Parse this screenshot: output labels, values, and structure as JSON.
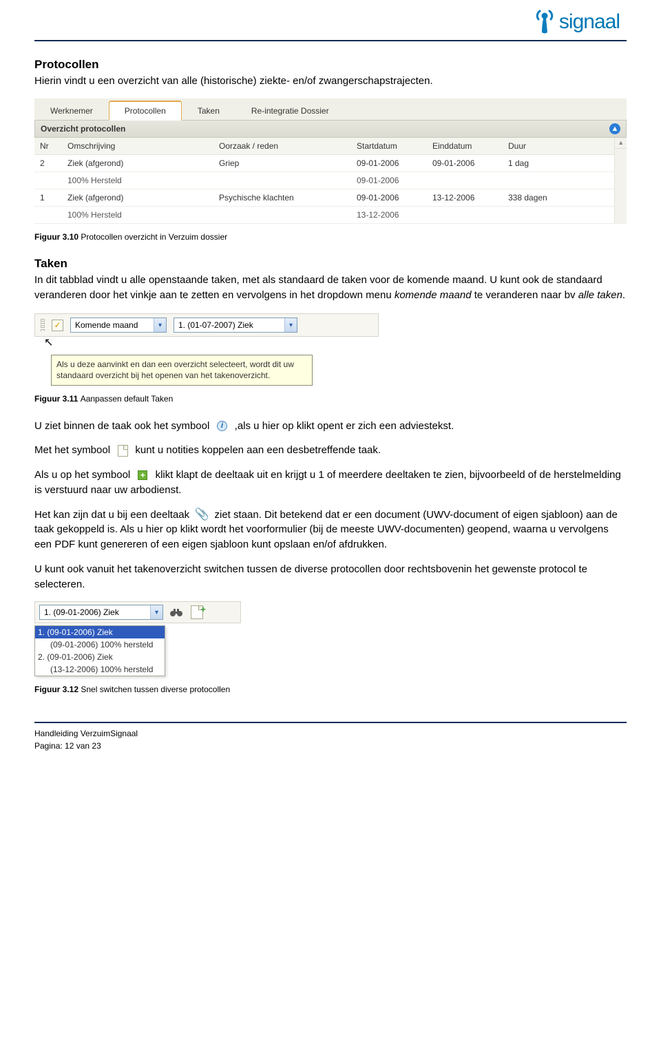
{
  "logo": {
    "brand": "signaal"
  },
  "sections": {
    "protocollen": {
      "heading": "Protocollen",
      "intro": "Hierin vindt u een overzicht van alle (historische) ziekte- en/of zwangerschapstrajecten."
    },
    "taken": {
      "heading": "Taken",
      "para1a": "In dit tabblad vindt u alle openstaande taken, met als standaard de taken voor de komende maand. U kunt ook de standaard veranderen door het vinkje aan te zetten en vervolgens in het dropdown menu ",
      "para1_em1": "komende maand",
      "para1b": " te veranderen naar bv ",
      "para1_em2": "alle taken",
      "para1c": "."
    }
  },
  "shot1": {
    "tabs": [
      "Werknemer",
      "Protocollen",
      "Taken",
      "Re-integratie Dossier"
    ],
    "panel_title": "Overzicht protocollen",
    "columns": [
      "Nr",
      "Omschrijving",
      "Oorzaak / reden",
      "Startdatum",
      "Einddatum",
      "Duur"
    ],
    "rows": [
      {
        "nr": "2",
        "omschrijving": "Ziek (afgerond)",
        "oorzaak": "Griep",
        "start": "09-01-2006",
        "eind": "09-01-2006",
        "duur": "1 dag"
      },
      {
        "nr": "",
        "omschrijving": "100% Hersteld",
        "oorzaak": "",
        "start": "09-01-2006",
        "eind": "",
        "duur": ""
      },
      {
        "nr": "1",
        "omschrijving": "Ziek (afgerond)",
        "oorzaak": "Psychische klachten",
        "start": "09-01-2006",
        "eind": "13-12-2006",
        "duur": "338 dagen"
      },
      {
        "nr": "",
        "omschrijving": "100% Hersteld",
        "oorzaak": "",
        "start": "13-12-2006",
        "eind": "",
        "duur": ""
      }
    ]
  },
  "captions": {
    "c310_b": "Figuur 3.10 ",
    "c310_t": "Protocollen overzicht in Verzuim dossier",
    "c311_b": "Figuur 3.11 ",
    "c311_t": "Aanpassen default Taken",
    "c312_b": "Figuur 3.12 ",
    "c312_t": "Snel switchen tussen diverse protocollen"
  },
  "shot2": {
    "combo1": "Komende maand",
    "combo2": "1. (01-07-2007) Ziek",
    "tooltip": "Als u deze aanvinkt en dan een overzicht selecteert, wordt dit uw standaard overzicht bij het openen van het takenoverzicht."
  },
  "taken_paras": {
    "p2a": "U ziet binnen de taak ook het symbool",
    "p2b": ",als u hier op klikt opent er zich een adviestekst.",
    "p3a": "Met het symbool",
    "p3b": "kunt u notities koppelen aan een desbetreffende taak.",
    "p4a": "Als u op het symbool",
    "p4b": "klikt klapt de deeltaak uit en krijgt u 1 of meerdere deeltaken te zien, bijvoorbeeld of de herstelmelding is verstuurd naar uw arbodienst.",
    "p5a": "Het kan zijn dat u bij een deeltaak",
    "p5b": "ziet staan. Dit betekend dat er een document (UWV-document of eigen sjabloon) aan de taak gekoppeld is. Als u hier op klikt wordt het voorformulier (bij de meeste UWV-documenten) geopend, waarna u vervolgens een PDF kunt genereren of een eigen sjabloon kunt opslaan en/of afdrukken.",
    "p6": "U kunt ook vanuit het takenoverzicht switchen tussen de diverse protocollen door rechtsbovenin het gewenste protocol te selecteren."
  },
  "shot3": {
    "selected": "1. (09-01-2006) Ziek",
    "options": [
      {
        "text": "1. (09-01-2006) Ziek",
        "selected": true,
        "indent": false
      },
      {
        "text": "(09-01-2006) 100% hersteld",
        "selected": false,
        "indent": true
      },
      {
        "text": "2. (09-01-2006) Ziek",
        "selected": false,
        "indent": false
      },
      {
        "text": "(13-12-2006) 100% hersteld",
        "selected": false,
        "indent": true
      }
    ]
  },
  "footer": {
    "line1": "Handleiding VerzuimSignaal",
    "line2": "Pagina: 12 van 23"
  }
}
